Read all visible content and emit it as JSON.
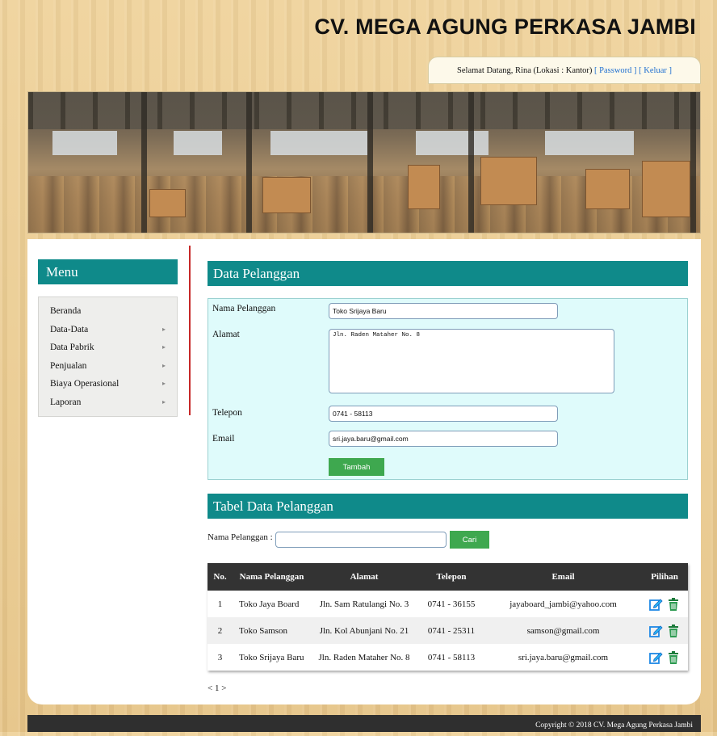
{
  "header": {
    "site_title": "CV. MEGA AGUNG PERKASA JAMBI",
    "welcome_text": "Selamat Datang, Rina (Lokasi : Kantor)",
    "password_link": "[ Password ]",
    "logout_link": "[ Keluar ]"
  },
  "sidebar": {
    "title": "Menu",
    "items": [
      {
        "label": "Beranda",
        "has_submenu": false
      },
      {
        "label": "Data-Data",
        "has_submenu": true
      },
      {
        "label": "Data Pabrik",
        "has_submenu": true
      },
      {
        "label": "Penjualan",
        "has_submenu": true
      },
      {
        "label": "Biaya Operasional",
        "has_submenu": true
      },
      {
        "label": "Laporan",
        "has_submenu": true
      }
    ]
  },
  "form": {
    "title": "Data Pelanggan",
    "name_label": "Nama Pelanggan",
    "name_value": "Toko Srijaya Baru",
    "address_label": "Alamat",
    "address_value": "Jln. Raden Mataher No. 8",
    "phone_label": "Telepon",
    "phone_value": "0741 - 58113",
    "email_label": "Email",
    "email_value": "sri.jaya.baru@gmail.com",
    "submit_label": "Tambah"
  },
  "table_section": {
    "title": "Tabel Data Pelanggan",
    "search_label": "Nama Pelanggan :",
    "search_value": "",
    "search_button": "Cari",
    "columns": [
      "No.",
      "Nama Pelanggan",
      "Alamat",
      "Telepon",
      "Email",
      "Pilihan"
    ],
    "rows": [
      {
        "no": "1",
        "name": "Toko Jaya Board",
        "address": "Jln. Sam Ratulangi No. 3",
        "phone": "0741 - 36155",
        "email": "jayaboard_jambi@yahoo.com"
      },
      {
        "no": "2",
        "name": "Toko Samson",
        "address": "Jln. Kol Abunjani No. 21",
        "phone": "0741 - 25311",
        "email": "samson@gmail.com"
      },
      {
        "no": "3",
        "name": "Toko Srijaya Baru",
        "address": "Jln. Raden Mataher No. 8",
        "phone": "0741 - 58113",
        "email": "sri.jaya.baru@gmail.com"
      }
    ],
    "row_actions": [
      "edit-icon",
      "delete-icon"
    ],
    "pagination": "< 1 >"
  },
  "footer": {
    "copyright": "Copyright © 2018 CV. Mega Agung Perkasa Jambi"
  },
  "colors": {
    "section_header": "#0f8a8a",
    "form_background": "#dffbfb",
    "button_green": "#3ea84f",
    "table_header": "#333333",
    "link_blue": "#1f6fd1",
    "divider_red": "#c62828"
  }
}
